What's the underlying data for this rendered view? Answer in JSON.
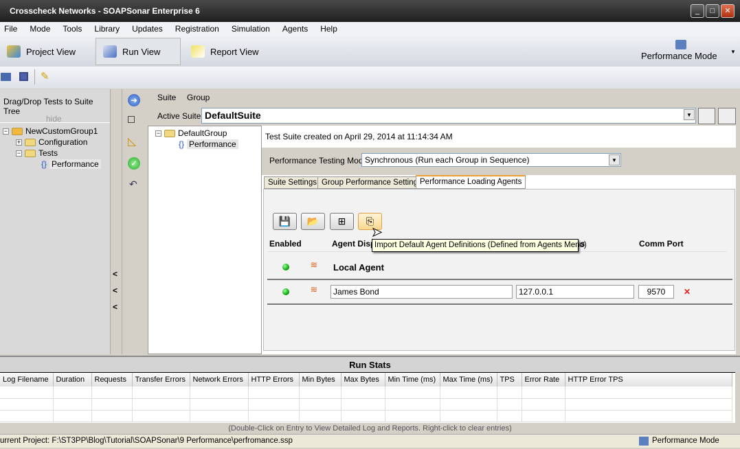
{
  "window": {
    "title": "Crosscheck Networks - SOAPSonar Enterprise 6"
  },
  "menu": [
    "File",
    "Mode",
    "Tools",
    "Library",
    "Updates",
    "Registration",
    "Simulation",
    "Agents",
    "Help"
  ],
  "views": {
    "project": "Project View",
    "run": "Run View",
    "report": "Report View",
    "mode": "Performance Mode"
  },
  "left": {
    "drag_label": "Drag/Drop Tests to Suite Tree",
    "hide": "hide",
    "tree": {
      "root": "NewCustomGroup1",
      "config": "Configuration",
      "tests": "Tests",
      "perf": "Performance"
    }
  },
  "collapse_arrows": [
    "<",
    "<",
    "<"
  ],
  "suite": {
    "menu_suite": "Suite",
    "menu_group": "Group",
    "active_label": "Active Suite:",
    "active_value": "DefaultSuite",
    "tree_group": "DefaultGroup",
    "tree_item": "Performance"
  },
  "main": {
    "created": "Test Suite created on April 29, 2014 at 11:14:34 AM",
    "mode_label": "Performance Testing Mode",
    "mode_value": "Synchronous (Run each Group in Sequence)",
    "tabs": [
      "Suite Settings",
      "Group Performance Settings",
      "Performance Loading Agents"
    ],
    "active_tab": 2,
    "headers": {
      "enabled": "Enabled",
      "display": "Agent Disp",
      "address": "ss",
      "port": "Comm Port"
    },
    "local_agent": "Local Agent",
    "agent": {
      "name": "James Bond",
      "address": "127.0.0.1",
      "port": "9570",
      "delete": "✕"
    },
    "tooltip": "Import Default Agent Definitions (Defined from Agents Menu)"
  },
  "runstats": {
    "title": "Run Stats",
    "columns": [
      "Log Filename",
      "Duration",
      "Requests",
      "Transfer Errors",
      "Network Errors",
      "HTTP Errors",
      "Min Bytes",
      "Max Bytes",
      "Min Time (ms)",
      "Max Time (ms)",
      "TPS",
      "Error Rate",
      "HTTP Error TPS"
    ],
    "hint": "(Double-Click on Entry to View Detailed Log and Reports.  Right-click to clear entries)"
  },
  "status": {
    "project": "urrent Project: F:\\ST3PP\\Blog\\Tutorial\\SOAPSonar\\9 Performance\\perfromance.ssp",
    "mode": "Performance Mode"
  }
}
